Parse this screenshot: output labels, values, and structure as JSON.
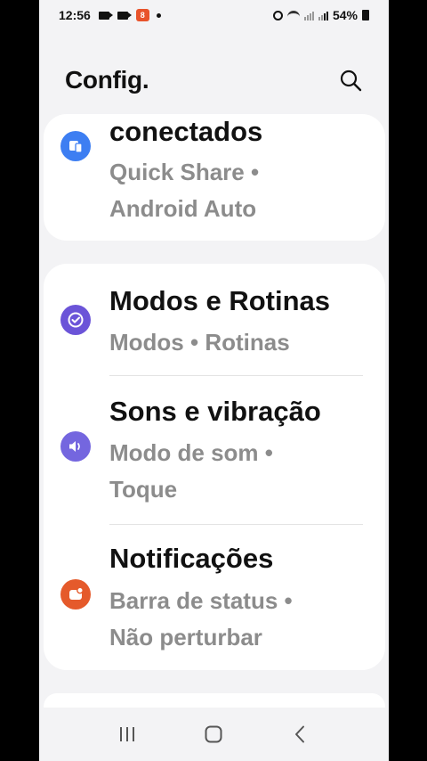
{
  "status_bar": {
    "time": "12:56",
    "app_badge": "8",
    "battery": "54%"
  },
  "header": {
    "title": "Config."
  },
  "cards": [
    {
      "items": [
        {
          "title": "conectados",
          "subtitle_line1": "Quick Share  •",
          "subtitle_line2": "Android Auto",
          "icon": "connected-devices-icon",
          "icon_color": "#3d7ef2"
        }
      ]
    },
    {
      "items": [
        {
          "title": "Modos e Rotinas",
          "subtitle_line1": "Modos  •  Rotinas",
          "icon": "modes-routines-icon",
          "icon_color": "#6b54d8"
        },
        {
          "title": "Sons e vibração",
          "subtitle_line1": "Modo de som  •",
          "subtitle_line2": "Toque",
          "icon": "volume-icon",
          "icon_color": "#7466df"
        },
        {
          "title": "Notificações",
          "subtitle_line1": "Barra de status  •",
          "subtitle_line2": "Não perturbar",
          "icon": "notifications-icon",
          "icon_color": "#e55a2b"
        }
      ]
    }
  ],
  "nav": {
    "recents": "recents-icon",
    "home": "home-icon",
    "back": "back-icon"
  }
}
